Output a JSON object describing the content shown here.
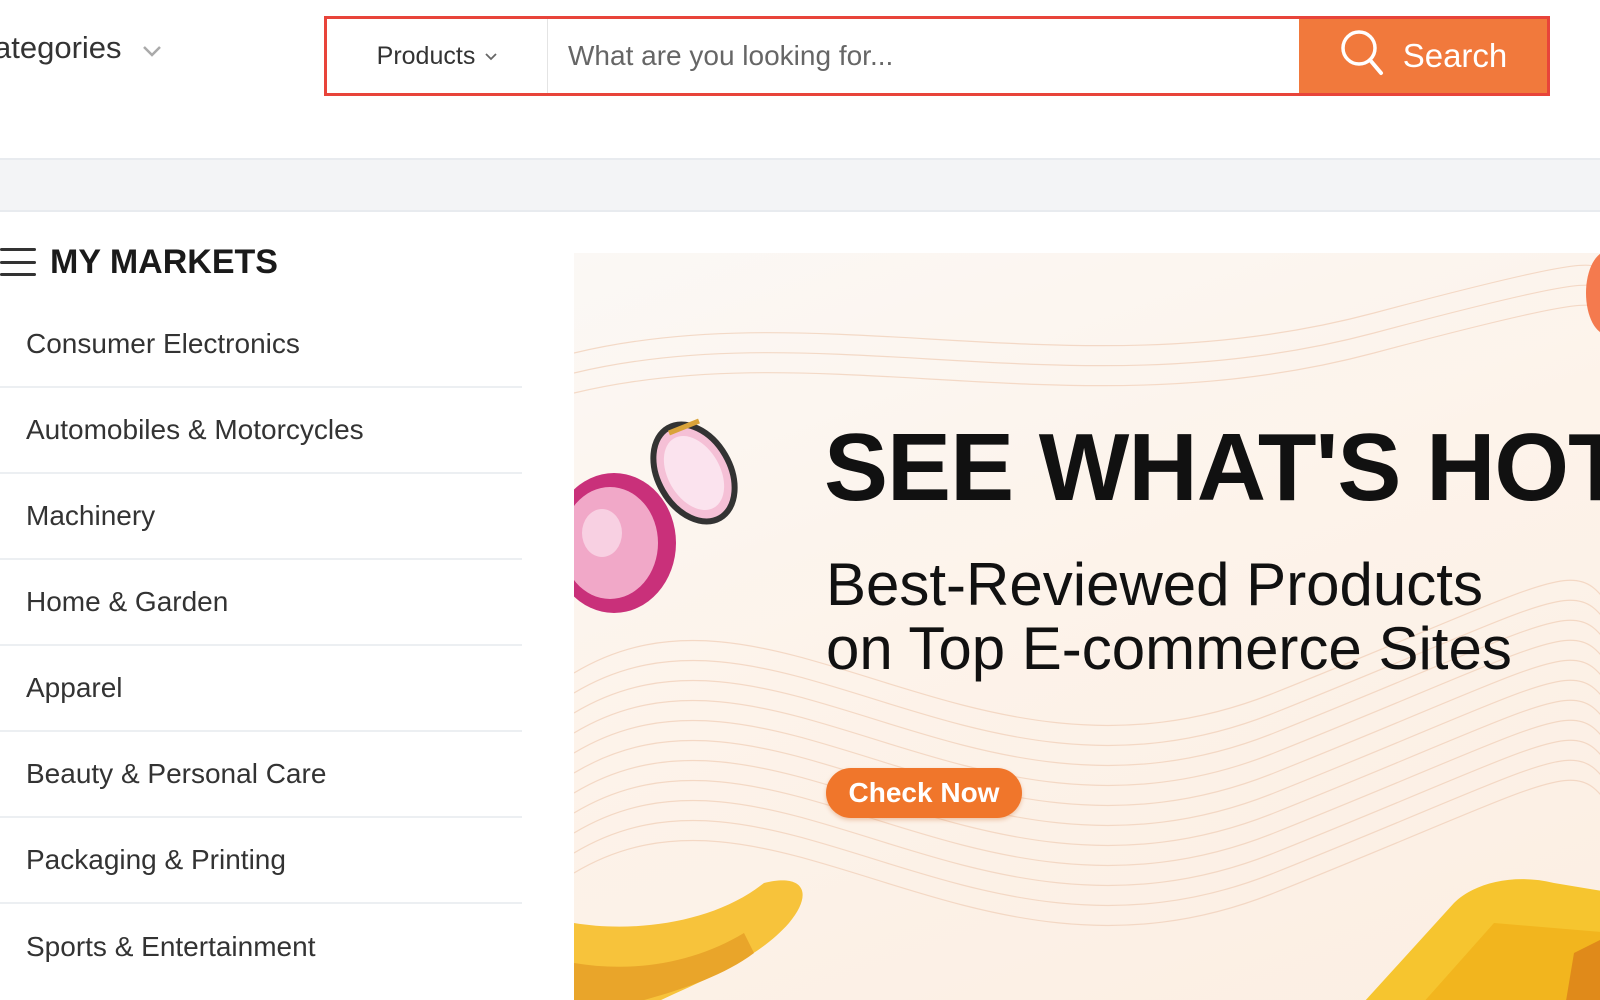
{
  "header": {
    "categories_label": "ategories",
    "search": {
      "type_label": "Products",
      "placeholder": "What are you looking for...",
      "value": "",
      "button_label": "Search"
    }
  },
  "sidebar": {
    "title": "MY MARKETS",
    "items": [
      {
        "label": "Consumer Electronics"
      },
      {
        "label": "Automobiles & Motorcycles"
      },
      {
        "label": "Machinery"
      },
      {
        "label": "Home & Garden"
      },
      {
        "label": "Apparel"
      },
      {
        "label": "Beauty & Personal Care"
      },
      {
        "label": "Packaging & Printing"
      },
      {
        "label": "Sports & Entertainment"
      }
    ]
  },
  "banner": {
    "title": "SEE WHAT'S HOT",
    "subtitle_line1": "Best-Reviewed Products",
    "subtitle_line2": "on Top E-commerce Sites",
    "cta_label": "Check Now"
  },
  "colors": {
    "accent": "#f1793c",
    "search_border": "#e8443a",
    "band": "#f3f4f6"
  },
  "icons": [
    "chevron-down-icon",
    "search-icon",
    "menu-icon"
  ]
}
